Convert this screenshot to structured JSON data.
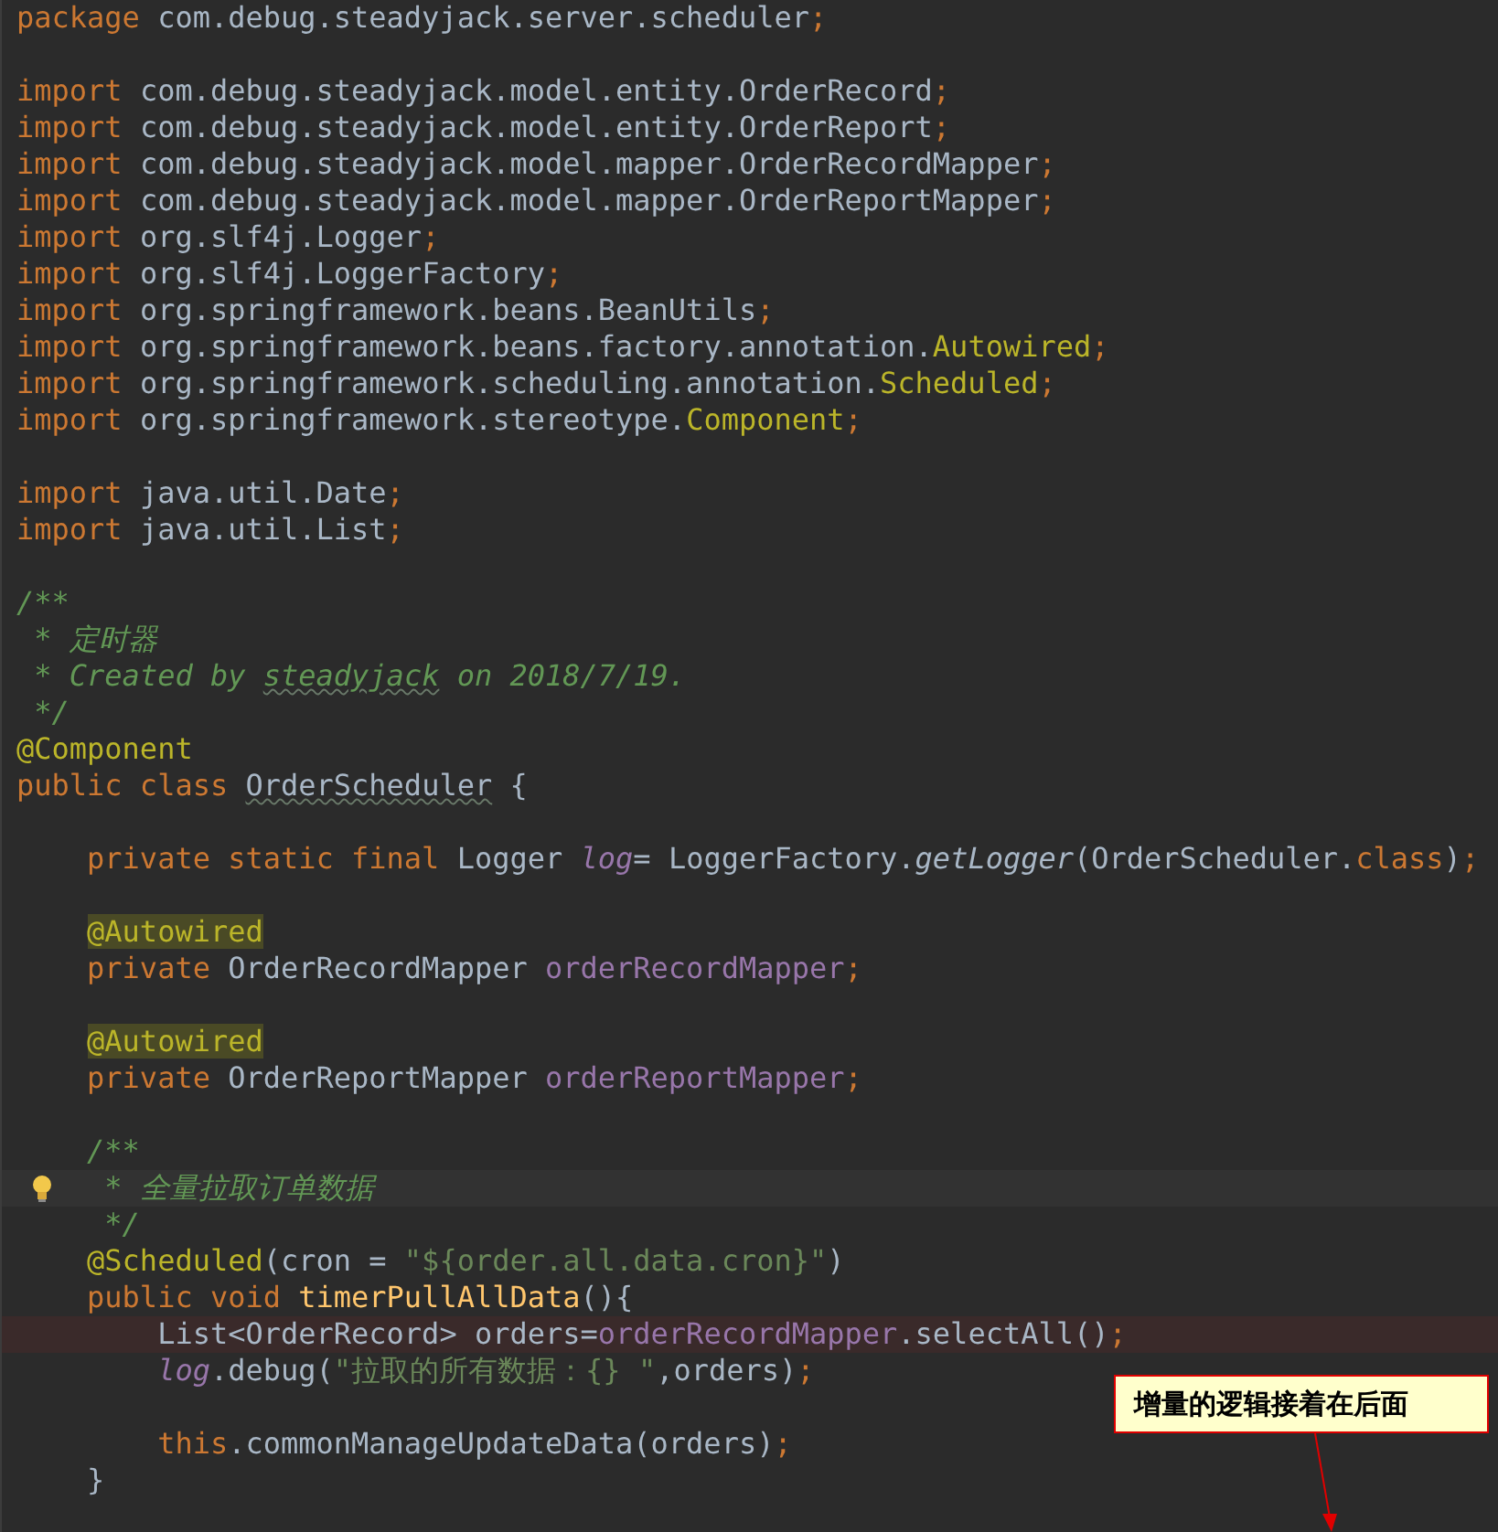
{
  "editor": {
    "lines": [
      {
        "kind": "plain",
        "tokens": [
          {
            "kind": "kw",
            "text": "package "
          },
          {
            "kind": "plain",
            "text": "com.debug.steadyjack.server.scheduler"
          },
          {
            "kind": "kw",
            "text": ";"
          }
        ]
      },
      {
        "kind": "blank"
      },
      {
        "kind": "plain",
        "tokens": [
          {
            "kind": "kw",
            "text": "import "
          },
          {
            "kind": "plain",
            "text": "com.debug.steadyjack.model.entity.OrderRecord"
          },
          {
            "kind": "kw",
            "text": ";"
          }
        ]
      },
      {
        "kind": "plain",
        "tokens": [
          {
            "kind": "kw",
            "text": "import "
          },
          {
            "kind": "plain",
            "text": "com.debug.steadyjack.model.entity.OrderReport"
          },
          {
            "kind": "kw",
            "text": ";"
          }
        ]
      },
      {
        "kind": "plain",
        "tokens": [
          {
            "kind": "kw",
            "text": "import "
          },
          {
            "kind": "plain",
            "text": "com.debug.steadyjack.model.mapper.OrderRecordMapper"
          },
          {
            "kind": "kw",
            "text": ";"
          }
        ]
      },
      {
        "kind": "plain",
        "tokens": [
          {
            "kind": "kw",
            "text": "import "
          },
          {
            "kind": "plain",
            "text": "com.debug.steadyjack.model.mapper.OrderReportMapper"
          },
          {
            "kind": "kw",
            "text": ";"
          }
        ]
      },
      {
        "kind": "plain",
        "tokens": [
          {
            "kind": "kw",
            "text": "import "
          },
          {
            "kind": "plain",
            "text": "org.slf4j.Logger"
          },
          {
            "kind": "kw",
            "text": ";"
          }
        ]
      },
      {
        "kind": "plain",
        "tokens": [
          {
            "kind": "kw",
            "text": "import "
          },
          {
            "kind": "plain",
            "text": "org.slf4j.LoggerFactory"
          },
          {
            "kind": "kw",
            "text": ";"
          }
        ]
      },
      {
        "kind": "plain",
        "tokens": [
          {
            "kind": "kw",
            "text": "import "
          },
          {
            "kind": "plain",
            "text": "org.springframework.beans.BeanUtils"
          },
          {
            "kind": "kw",
            "text": ";"
          }
        ]
      },
      {
        "kind": "plain",
        "tokens": [
          {
            "kind": "kw",
            "text": "import "
          },
          {
            "kind": "plain",
            "text": "org.springframework.beans.factory.annotation."
          },
          {
            "kind": "anno",
            "text": "Autowired"
          },
          {
            "kind": "kw",
            "text": ";"
          }
        ]
      },
      {
        "kind": "plain",
        "tokens": [
          {
            "kind": "kw",
            "text": "import "
          },
          {
            "kind": "plain",
            "text": "org.springframework.scheduling.annotation."
          },
          {
            "kind": "anno",
            "text": "Scheduled"
          },
          {
            "kind": "kw",
            "text": ";"
          }
        ]
      },
      {
        "kind": "plain",
        "tokens": [
          {
            "kind": "kw",
            "text": "import "
          },
          {
            "kind": "plain",
            "text": "org.springframework.stereotype."
          },
          {
            "kind": "anno",
            "text": "Component"
          },
          {
            "kind": "kw",
            "text": ";"
          }
        ]
      },
      {
        "kind": "blank"
      },
      {
        "kind": "plain",
        "tokens": [
          {
            "kind": "kw",
            "text": "import "
          },
          {
            "kind": "plain",
            "text": "java.util.Date"
          },
          {
            "kind": "kw",
            "text": ";"
          }
        ]
      },
      {
        "kind": "plain",
        "tokens": [
          {
            "kind": "kw",
            "text": "import "
          },
          {
            "kind": "plain",
            "text": "java.util.List"
          },
          {
            "kind": "kw",
            "text": ";"
          }
        ]
      },
      {
        "kind": "blank"
      },
      {
        "kind": "plain",
        "tokens": [
          {
            "kind": "doc",
            "text": "/**"
          }
        ]
      },
      {
        "kind": "plain",
        "tokens": [
          {
            "kind": "doc",
            "text": " * 定时器"
          }
        ]
      },
      {
        "kind": "plain",
        "tokens": [
          {
            "kind": "doc",
            "text": " * Created by "
          },
          {
            "kind": "docwavy",
            "text": "steadyjack"
          },
          {
            "kind": "doc",
            "text": " on 2018/7/19."
          }
        ]
      },
      {
        "kind": "plain",
        "tokens": [
          {
            "kind": "doc",
            "text": " */"
          }
        ]
      },
      {
        "kind": "plain",
        "tokens": [
          {
            "kind": "anno",
            "text": "@Component"
          }
        ]
      },
      {
        "kind": "plain",
        "tokens": [
          {
            "kind": "kw",
            "text": "public class "
          },
          {
            "kind": "unused",
            "text": "OrderScheduler"
          },
          {
            "kind": "plain",
            "text": " {"
          }
        ]
      },
      {
        "kind": "blank"
      },
      {
        "kind": "plain",
        "tokens": [
          {
            "kind": "kw",
            "text": "    private static final "
          },
          {
            "kind": "plain",
            "text": "Logger "
          },
          {
            "kind": "staticfield",
            "text": "log"
          },
          {
            "kind": "plain",
            "text": "= LoggerFactory."
          },
          {
            "kind": "italic",
            "text": "getLogger"
          },
          {
            "kind": "plain",
            "text": "(OrderScheduler."
          },
          {
            "kind": "kw",
            "text": "class"
          },
          {
            "kind": "plain",
            "text": ")"
          },
          {
            "kind": "kw",
            "text": ";"
          }
        ]
      },
      {
        "kind": "blank"
      },
      {
        "kind": "plain",
        "tokens": [
          {
            "kind": "annohl",
            "text": "    @Autowired"
          }
        ]
      },
      {
        "kind": "plain",
        "tokens": [
          {
            "kind": "kw",
            "text": "    private "
          },
          {
            "kind": "plain",
            "text": "OrderRecordMapper "
          },
          {
            "kind": "field",
            "text": "orderRecordMapper"
          },
          {
            "kind": "kw",
            "text": ";"
          }
        ]
      },
      {
        "kind": "blank"
      },
      {
        "kind": "plain",
        "tokens": [
          {
            "kind": "annohl",
            "text": "    @Autowired"
          }
        ]
      },
      {
        "kind": "plain",
        "tokens": [
          {
            "kind": "kw",
            "text": "    private "
          },
          {
            "kind": "plain",
            "text": "OrderReportMapper "
          },
          {
            "kind": "field",
            "text": "orderReportMapper"
          },
          {
            "kind": "kw",
            "text": ";"
          }
        ]
      },
      {
        "kind": "blank"
      },
      {
        "kind": "plain",
        "tokens": [
          {
            "kind": "doc",
            "text": "    /**"
          }
        ]
      },
      {
        "kind": "current",
        "tokens": [
          {
            "kind": "doc",
            "text": "     * 全量拉取订单数据"
          }
        ]
      },
      {
        "kind": "plain",
        "tokens": [
          {
            "kind": "doc",
            "text": "     */"
          }
        ]
      },
      {
        "kind": "plain",
        "tokens": [
          {
            "kind": "anno",
            "text": "    @Scheduled"
          },
          {
            "kind": "plain",
            "text": "(cron = "
          },
          {
            "kind": "str",
            "text": "\"${order.all.data.cron}\""
          },
          {
            "kind": "plain",
            "text": ")"
          }
        ]
      },
      {
        "kind": "plain",
        "tokens": [
          {
            "kind": "kw",
            "text": "    public void "
          },
          {
            "kind": "method",
            "text": "timerPullAllData"
          },
          {
            "kind": "plain",
            "text": "(){"
          }
        ]
      },
      {
        "kind": "error",
        "tokens": [
          {
            "kind": "plain",
            "text": "        List<OrderRecord> orders="
          },
          {
            "kind": "field",
            "text": "orderRecordMapper"
          },
          {
            "kind": "plain",
            "text": ".selectAll()"
          },
          {
            "kind": "kw",
            "text": ";"
          }
        ]
      },
      {
        "kind": "plain",
        "tokens": [
          {
            "kind": "staticfield",
            "text": "        log"
          },
          {
            "kind": "plain",
            "text": ".debug("
          },
          {
            "kind": "str",
            "text": "\"拉取的所有数据：{} \""
          },
          {
            "kind": "plain",
            "text": ",orders)"
          },
          {
            "kind": "kw",
            "text": ";"
          }
        ]
      },
      {
        "kind": "blank"
      },
      {
        "kind": "plain",
        "tokens": [
          {
            "kind": "kw",
            "text": "        this"
          },
          {
            "kind": "plain",
            "text": ".commonManageUpdateData(orders)"
          },
          {
            "kind": "kw",
            "text": ";"
          }
        ]
      },
      {
        "kind": "plain",
        "tokens": [
          {
            "kind": "plain",
            "text": "    }"
          }
        ]
      }
    ]
  },
  "callout": {
    "text": "增量的逻辑接着在后面"
  }
}
